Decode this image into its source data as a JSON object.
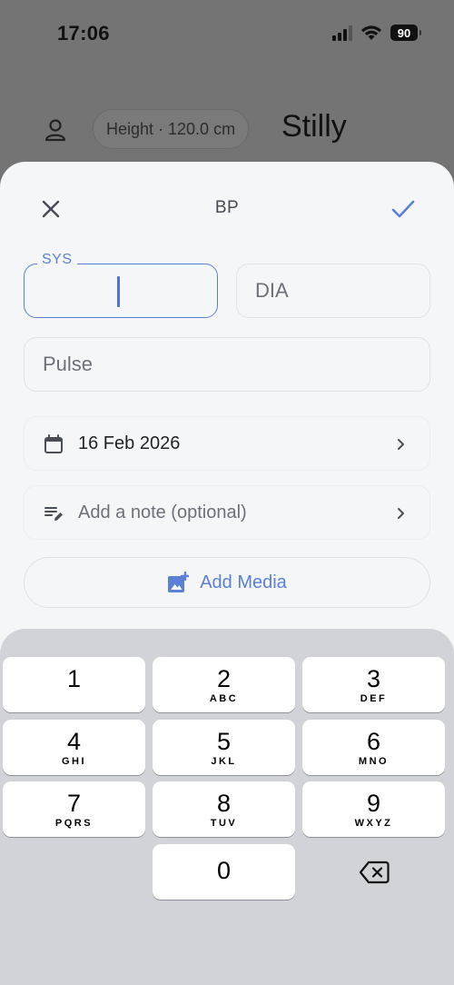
{
  "status_bar": {
    "time": "17:06",
    "battery": "90"
  },
  "background": {
    "height_chip": "Height · 120.0 cm",
    "title": "Stilly"
  },
  "sheet": {
    "title": "BP",
    "sys_label": "SYS",
    "dia_placeholder": "DIA",
    "pulse_placeholder": "Pulse",
    "date": "16 Feb 2026",
    "note_placeholder": "Add a note (optional)",
    "media_label": "Add Media"
  },
  "keypad": {
    "keys": [
      {
        "num": "1",
        "letters": ""
      },
      {
        "num": "2",
        "letters": "ABC"
      },
      {
        "num": "3",
        "letters": "DEF"
      },
      {
        "num": "4",
        "letters": "GHI"
      },
      {
        "num": "5",
        "letters": "JKL"
      },
      {
        "num": "6",
        "letters": "MNO"
      },
      {
        "num": "7",
        "letters": "PQRS"
      },
      {
        "num": "8",
        "letters": "TUV"
      },
      {
        "num": "9",
        "letters": "WXYZ"
      },
      {
        "num": "0",
        "letters": ""
      }
    ]
  },
  "colors": {
    "accent": "#5b80d6",
    "sheet_bg": "#f5f6f8",
    "keypad_bg": "#d1d3d9"
  },
  "icons": [
    "person-icon",
    "close-icon",
    "check-icon",
    "calendar-icon",
    "note-edit-icon",
    "chevron-right-icon",
    "add-photo-icon",
    "backspace-icon",
    "signal-icon",
    "wifi-icon",
    "battery-icon"
  ]
}
